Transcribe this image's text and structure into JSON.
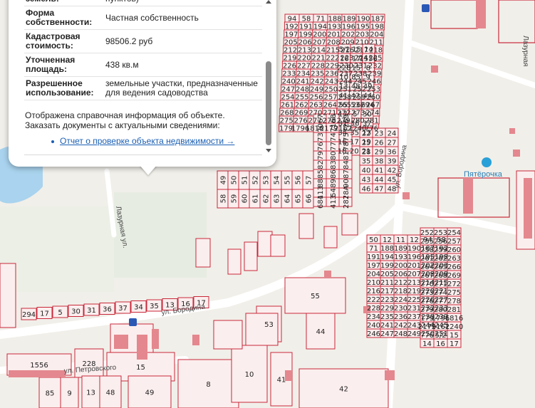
{
  "colors": {
    "parcel_stroke": "#c8283a",
    "parcel_fill": "#fbeeee",
    "building": "#e4878e",
    "water": "#a9d3ee",
    "road": "#ffffff",
    "background": "#f1efe9",
    "link": "#1a5fb4",
    "bus_stop": "#2a58b5",
    "store_icon": "#2aa0d8"
  },
  "popup": {
    "rows": [
      {
        "key": "земель:",
        "value": "пунктов)"
      },
      {
        "key": "Форма собственности:",
        "value": "Частная собственность"
      },
      {
        "key": "Кадастровая стоимость:",
        "value": "98506.2 руб"
      },
      {
        "key": "Уточненная площадь:",
        "value": "438 кв.м"
      },
      {
        "key": "Разрешенное использование:",
        "value": "земельные участки, предназначенные для ведения садоводства"
      }
    ],
    "note": "Отображена справочная информация об объекте. Заказать документы с актуальными сведениями:",
    "link_label": "Отчет о проверке объекта недвижимости →"
  },
  "map": {
    "street_labels": [
      {
        "name": "ул. Бородина",
        "icon": "street-label"
      },
      {
        "name": "ул. Бородина",
        "icon": "street-label"
      },
      {
        "name": "ул. Петровского",
        "icon": "street-label"
      },
      {
        "name": "Лазурная ул.",
        "icon": "street-label"
      },
      {
        "name": "Лазурная",
        "icon": "street-label"
      }
    ],
    "store_label": "Пятёрочка",
    "parcel_numbers": [
      "94",
      "58",
      "71",
      "188",
      "189",
      "190",
      "187",
      "192",
      "191",
      "194",
      "193",
      "196",
      "195",
      "198",
      "197",
      "199",
      "200",
      "201",
      "202",
      "203",
      "204",
      "205",
      "206",
      "207",
      "208",
      "209",
      "210",
      "211",
      "212",
      "213",
      "214",
      "215",
      "216",
      "217",
      "218",
      "219",
      "220",
      "221",
      "222",
      "223",
      "224",
      "225",
      "226",
      "227",
      "228",
      "229",
      "230",
      "231",
      "232",
      "233",
      "234",
      "235",
      "236",
      "237",
      "238",
      "239",
      "240",
      "241",
      "242",
      "243",
      "244",
      "245",
      "246",
      "247",
      "248",
      "249",
      "250",
      "251",
      "252",
      "253",
      "254",
      "255",
      "256",
      "257",
      "258",
      "259",
      "260",
      "261",
      "262",
      "263",
      "264",
      "265",
      "266",
      "267",
      "268",
      "269",
      "270",
      "271",
      "272",
      "273",
      "274",
      "275",
      "276",
      "277",
      "278",
      "279",
      "280",
      "281",
      "179",
      "1796",
      "1816",
      "2179",
      "2162",
      "1240",
      "776",
      "5/2",
      "15",
      "14",
      "16",
      "17",
      "1556",
      "228",
      "15",
      "8",
      "10",
      "85",
      "9",
      "13",
      "48",
      "49",
      "41",
      "42",
      "44",
      "55",
      "53",
      "294",
      "17",
      "5",
      "30",
      "31",
      "36",
      "37",
      "34",
      "35",
      "13",
      "16",
      "17",
      "19",
      "18",
      "20",
      "21",
      "22",
      "23",
      "24",
      "25",
      "26",
      "27",
      "28",
      "29",
      "36",
      "35",
      "38",
      "39",
      "40",
      "41",
      "42",
      "43",
      "44",
      "45",
      "46",
      "47",
      "48",
      "49",
      "50",
      "51",
      "52",
      "53",
      "54",
      "55",
      "56",
      "57",
      "58",
      "59",
      "60",
      "61",
      "62",
      "63",
      "64",
      "65",
      "66",
      "67",
      "68",
      "69",
      "70",
      "71",
      "72",
      "73",
      "74",
      "75",
      "76",
      "77",
      "78",
      "79",
      "80",
      "81",
      "82",
      "83",
      "84",
      "85",
      "86",
      "87",
      "88",
      "89",
      "90",
      "113",
      "54",
      "28А",
      "684",
      "413",
      "287",
      "50",
      "12",
      "11",
      "12"
    ]
  }
}
